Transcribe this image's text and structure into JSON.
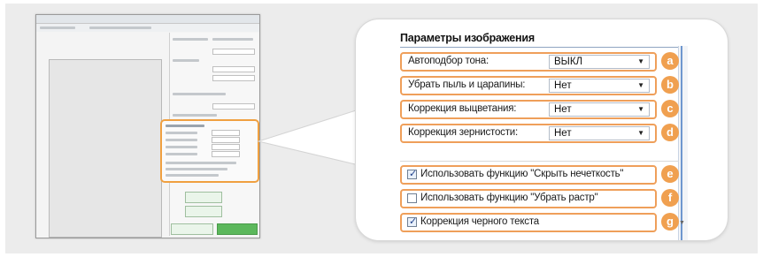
{
  "panel": {
    "title": "Параметры изображения",
    "rows": [
      {
        "label": "Автоподбор тона:",
        "value": "ВЫКЛ",
        "badge": "a"
      },
      {
        "label": "Убрать пыль и царапины:",
        "value": "Нет",
        "badge": "b"
      },
      {
        "label": "Коррекция выцветания:",
        "value": "Нет",
        "badge": "c"
      },
      {
        "label": "Коррекция зернистости:",
        "value": "Нет",
        "badge": "d"
      }
    ],
    "checkboxes": [
      {
        "label": "Использовать функцию \"Скрыть нечеткость\"",
        "checked": true,
        "badge": "e"
      },
      {
        "label": "Использовать функцию \"Убрать растр\"",
        "checked": false,
        "badge": "f"
      },
      {
        "label": "Коррекция черного текста",
        "checked": true,
        "badge": "g"
      }
    ]
  },
  "icons": {
    "dropdown": "chevron-down-icon",
    "check": "checkmark-icon"
  },
  "colors": {
    "highlight": "#ef9f5a",
    "badge": "#f0a050",
    "accent": "#6f97cf"
  }
}
